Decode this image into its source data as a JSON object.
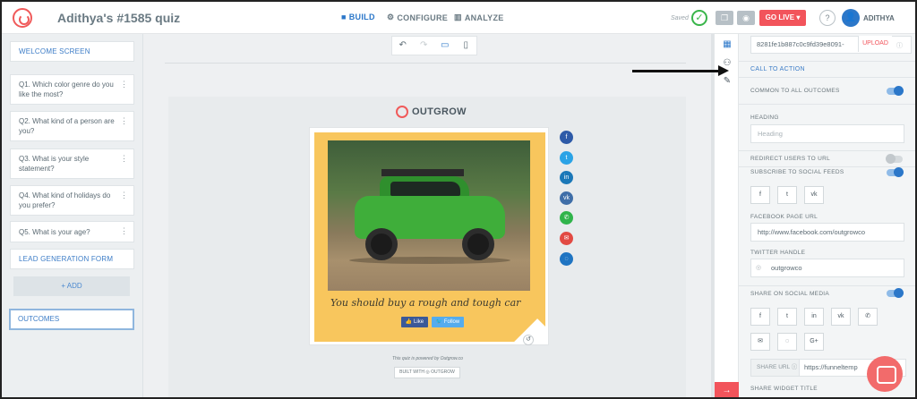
{
  "app": {
    "title": "Adithya's #1585 quiz",
    "saved": "Saved",
    "golive": "GO LIVE ▾",
    "help": "?",
    "user": "ADITHYA",
    "avatar": "👤"
  },
  "nav": {
    "build": "BUILD",
    "configure": "CONFIGURE",
    "analyze": "ANALYZE"
  },
  "sidebar": {
    "welcome": "WELCOME SCREEN",
    "questions": [
      "Q1. Which color genre do you like the most?",
      "Q2. What kind of a person are you?",
      "Q3. What is your style statement?",
      "Q4. What kind of holidays do you prefer?",
      "Q5. What is your age?"
    ],
    "lead_form": "LEAD GENERATION FORM",
    "add": "+ ADD",
    "outcomes": "OUTCOMES"
  },
  "canvas": {
    "brand": "OUTGROW",
    "result_text": "You should buy a rough and tough car",
    "like": "👍 Like",
    "follow": "🐦 Follow",
    "powered": "This quiz is powered by Outgrow.co",
    "built_with": "BUILT WITH ◎ OUTGROW"
  },
  "panel": {
    "url_value": "8281fe1b887c0c9fd39e8091-",
    "upload": "UPLOAD",
    "call_to_action": "CALL TO ACTION",
    "common_to_all": "COMMON TO ALL OUTCOMES",
    "heading_label": "HEADING",
    "heading_placeholder": "Heading",
    "redirect_label": "REDIRECT USERS TO URL",
    "subscribe_label": "SUBSCRIBE TO SOCIAL FEEDS",
    "fb_url_label": "FACEBOOK PAGE URL",
    "fb_url_value": "http://www.facebook.com/outgrowco",
    "twitter_label": "TWITTER HANDLE",
    "twitter_value": "outgrowco",
    "share_label": "SHARE ON SOCIAL MEDIA",
    "share_url_label": "SHARE URL",
    "share_url_value": "https://funneltemp",
    "share_widget_title": "SHARE WIDGET TITLE"
  },
  "icons": {
    "build": "■",
    "configure": "⚙",
    "analyze": "▥"
  },
  "colors": {
    "accent": "#2b77c9",
    "golive": "#f2545b",
    "card_bg": "#f8c65d"
  }
}
